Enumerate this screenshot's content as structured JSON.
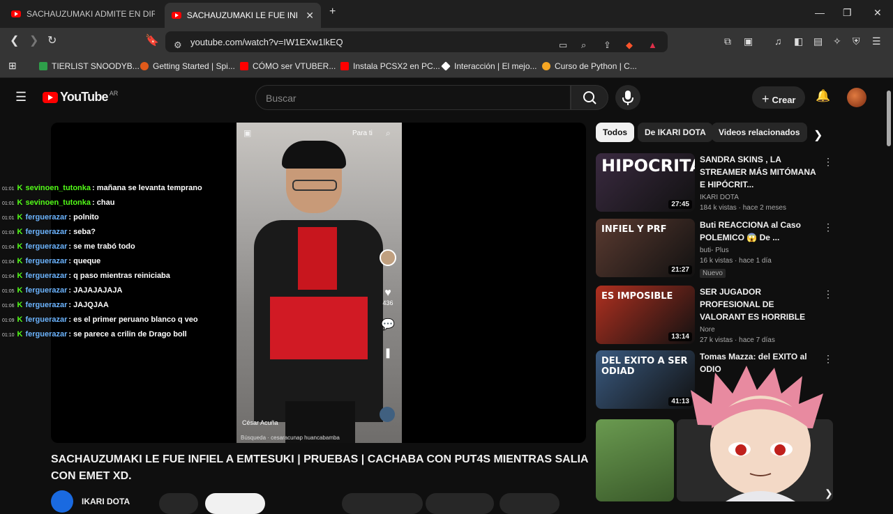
{
  "browser": {
    "tabs": [
      {
        "title": "SACHAUZUMAKI ADMITE EN DIRECT"
      },
      {
        "title": "SACHAUZUMAKI LE FUE INFIEL A",
        "close": "✕"
      }
    ],
    "new_tab": "+",
    "window_controls": {
      "minimize": "—",
      "maximize": "❐",
      "close": "✕"
    },
    "url": "youtube.com/watch?v=IW1EXw1lkEQ",
    "bookmarks": [
      {
        "label": "TIERLIST SNOODYB...",
        "icon_color": "#2e9e4a"
      },
      {
        "label": "Getting Started | Spi...",
        "icon_color": "#e05a1a"
      },
      {
        "label": "CÓMO ser VTUBER...",
        "icon_color": "#ff0000"
      },
      {
        "label": "Instala PCSX2 en PC...",
        "icon_color": "#ff0000"
      },
      {
        "label": "Interacción | El mejo...",
        "icon_color": "#ffffff"
      },
      {
        "label": "Curso de Python | C...",
        "icon_color": "#f5a623"
      }
    ]
  },
  "youtube": {
    "logo_text": "YouTube",
    "country": "AR",
    "search_placeholder": "Buscar",
    "create_label": "Crear"
  },
  "player": {
    "tiktok_tab": "Para ti",
    "tiktok_likes": "436",
    "tiktok_author": "César Acuña",
    "tiktok_search": "Búsqueda · cesaracunap huancabamba"
  },
  "chat": [
    {
      "time": "01:01",
      "user": "sevinoen_tutonka",
      "user_color": "#53fc18",
      "msg": ": mañana se levanta temprano"
    },
    {
      "time": "01:01",
      "user": "sevinoen_tutonka",
      "user_color": "#53fc18",
      "msg": ": chau"
    },
    {
      "time": "01:01",
      "user": "ferguerazar",
      "user_color": "#6cb4ff",
      "msg": ": polnito"
    },
    {
      "time": "01:03",
      "user": "ferguerazar",
      "user_color": "#6cb4ff",
      "msg": ": seba?"
    },
    {
      "time": "01:04",
      "user": "ferguerazar",
      "user_color": "#6cb4ff",
      "msg": ": se me trabó todo"
    },
    {
      "time": "01:04",
      "user": "ferguerazar",
      "user_color": "#6cb4ff",
      "msg": ": queque"
    },
    {
      "time": "01:04",
      "user": "ferguerazar",
      "user_color": "#6cb4ff",
      "msg": ": q paso mientras reiniciaba"
    },
    {
      "time": "01:05",
      "user": "ferguerazar",
      "user_color": "#6cb4ff",
      "msg": ": JAJAJAJAJA"
    },
    {
      "time": "01:06",
      "user": "ferguerazar",
      "user_color": "#6cb4ff",
      "msg": ": JAJQJAA"
    },
    {
      "time": "01:09",
      "user": "ferguerazar",
      "user_color": "#6cb4ff",
      "msg": ": es el primer peruano blanco q veo"
    },
    {
      "time": "01:10",
      "user": "ferguerazar",
      "user_color": "#6cb4ff",
      "msg": ": se parece a crilin de Drago boll"
    }
  ],
  "chips": [
    "Todos",
    "De IKARI DOTA",
    "Videos relacionados"
  ],
  "recommendations": [
    {
      "thumb_text": "HIPOCRITA",
      "duration": "27:45",
      "title": "SANDRA SKINS , LA STREAMER MÁS MITÓMANA E HIPÓCRIT...",
      "channel": "IKARI DOTA",
      "stats": "184 k vistas · hace 2 meses",
      "badge": "",
      "thumb_bg": "#3a2a40"
    },
    {
      "thumb_text": "INFIEL Y PRF",
      "duration": "21:27",
      "title": "Buti REACCIONA al Caso POLEMICO 😱 De ...",
      "channel": "buti- Plus",
      "stats": "16 k vistas · hace 1 día",
      "badge": "Nuevo",
      "thumb_bg": "#5a3a30"
    },
    {
      "thumb_text": "ES IMPOSIBLE",
      "duration": "13:14",
      "title": "SER JUGADOR PROFESIONAL DE VALORANT ES HORRIBLE",
      "channel": "Nore",
      "stats": "27 k vistas · hace 7 días",
      "badge": "",
      "thumb_bg": "#b03020"
    },
    {
      "thumb_text": "DEL EXITO A SER ODIAD",
      "duration": "41:13",
      "title": "Tomas Mazza: del EXITO al ODIO",
      "channel": "",
      "stats": "",
      "badge": "",
      "thumb_bg": "#3a5a80"
    }
  ],
  "video": {
    "title": "SACHAUZUMAKI LE FUE INFIEL A EMTESUKI | PRUEBAS | CACHABA CON PUT4S MIENTRAS SALIA CON EMET XD.",
    "channel": "IKARI DOTA"
  }
}
